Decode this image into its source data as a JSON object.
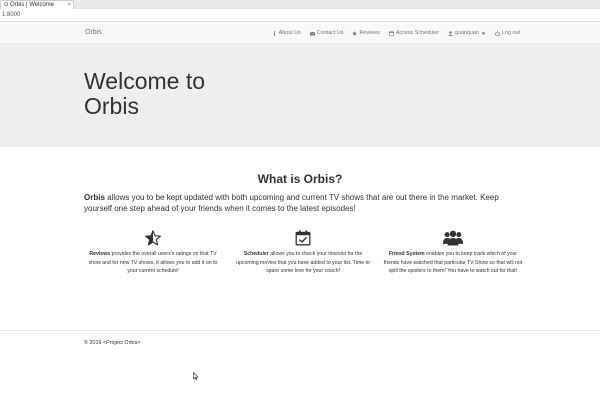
{
  "browser": {
    "tab_title": "Orbis | Welcome",
    "tab_close": "×",
    "url": "1:8000"
  },
  "navbar": {
    "brand": "Orbis",
    "links": [
      {
        "label": "About Us",
        "icon": "info-icon"
      },
      {
        "label": "Contact Us",
        "icon": "envelope-icon"
      },
      {
        "label": "Reviews",
        "icon": "star-icon"
      },
      {
        "label": "Access Scheduler",
        "icon": "calendar-icon"
      },
      {
        "label": "guanquan",
        "icon": "user-icon"
      },
      {
        "label": "Log out",
        "icon": "power-icon"
      }
    ]
  },
  "jumbotron": {
    "title_line1": "Welcome to",
    "title_line2": "Orbis"
  },
  "main": {
    "heading": "What is Orbis?",
    "intro_brand": "Orbis",
    "intro_text": " allows you to be kept updated with both upcoming and current TV shows that are out there in the market. Keep yourself one step ahead of your friends when it comes to the latest episodes!",
    "features": [
      {
        "icon": "half-star-icon",
        "title": "Reviews",
        "text": " provides the overall users's ratings on that TV show and for new TV shows, it allows you to add it on to your current schedule!"
      },
      {
        "icon": "calendar-check-icon",
        "title": "Scheduler",
        "text": " allows you to check your timeslot for the upcoming movies that you have added to your list. Time to spare some love for your couch!"
      },
      {
        "icon": "users-icon",
        "title": "Friend System",
        "text": " enables you to keep track which of your friends have watched that particular TV Show so that will not spill the spoilers to them! You have to watch out for that!"
      }
    ]
  },
  "footer": {
    "text": "© 2016 <Project Orbis>"
  }
}
